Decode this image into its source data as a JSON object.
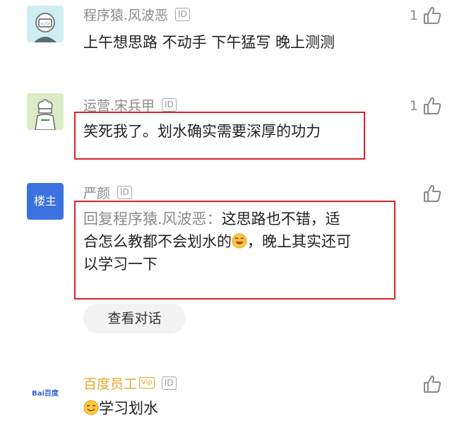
{
  "comments": [
    {
      "author": "程序猿.风波恶",
      "id_badge": "ID",
      "text": "上午想思路 不动手 下午猛写 晚上测测",
      "likes": "1"
    },
    {
      "author": "运营.宋兵甲",
      "id_badge": "ID",
      "text": "笑死我了。划水确实需要深厚的功力",
      "likes": "1"
    },
    {
      "author": "严颜",
      "id_badge": "ID",
      "owner_badge": "楼主",
      "reply_prefix": "回复程序猿.风波恶：",
      "text_line1": "这思路也不错，适",
      "text_line2": "合怎么教都不会划水的",
      "text_line2_after": "，晚上其实还可",
      "text_line3": "以学习一下",
      "view_conversation": "查看对话"
    },
    {
      "author": "百度员工",
      "vip_badge": "Vip",
      "id_badge": "ID",
      "avatar_text": "Bai百度",
      "text": "学习划水"
    }
  ],
  "colors": {
    "highlight_border": "#d8232a",
    "owner_badge_bg": "#3b72e0",
    "gold_name": "#e2a72a",
    "muted_text": "#8a8a8a"
  },
  "icons": [
    "thumbs-up-icon",
    "grin-emoji-icon",
    "smile-emoji-icon",
    "robot-avatar-icon",
    "chef-avatar-icon"
  ]
}
